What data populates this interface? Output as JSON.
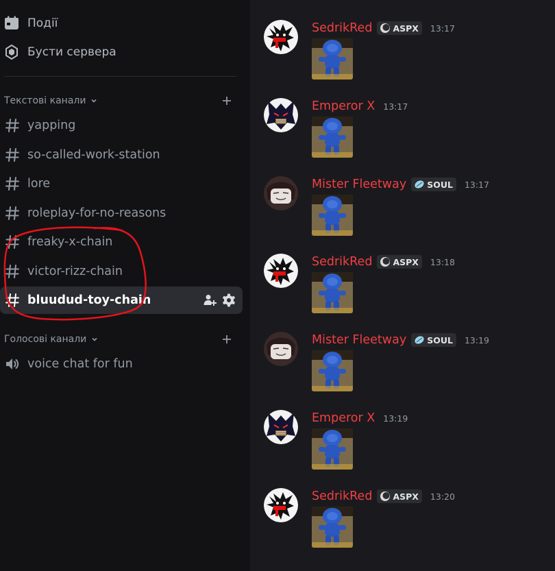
{
  "sidebar": {
    "events_label": "Події",
    "boosts_label": "Бусти сервера",
    "text_category": "Текстові канали",
    "voice_category": "Голосові канали",
    "text_channels": [
      "yapping",
      "so-called-work-station",
      "lore",
      "roleplay-for-no-reasons",
      "freaky-x-chain",
      "victor-rizz-chain",
      "bluudud-toy-chain"
    ],
    "active_channel": "bluudud-toy-chain",
    "voice_channels": [
      "voice chat for fun"
    ],
    "icons": {
      "events": "calendar-icon",
      "boosts": "server-boost-icon",
      "text_channel": "hash-icon",
      "voice_channel": "speaker-icon",
      "invite": "add-member-icon",
      "settings": "gear-icon"
    }
  },
  "messages": [
    {
      "author": "SedrikRed",
      "tag": "ASPX",
      "time": "13:17"
    },
    {
      "author": "Emperor X",
      "tag": "",
      "time": "13:17"
    },
    {
      "author": "Mister Fleetway",
      "tag": "SOUL",
      "time": "13:17"
    },
    {
      "author": "SedrikRed",
      "tag": "ASPX",
      "time": "13:18"
    },
    {
      "author": "Mister Fleetway",
      "tag": "SOUL",
      "time": "13:19"
    },
    {
      "author": "Emperor X",
      "tag": "",
      "time": "13:19"
    },
    {
      "author": "SedrikRed",
      "tag": "ASPX",
      "time": "13:20"
    }
  ],
  "colors": {
    "username": "#f23f43",
    "sidebar_bg": "#121214",
    "chat_bg": "#1a1a1e",
    "annotation": "#e4141c"
  }
}
